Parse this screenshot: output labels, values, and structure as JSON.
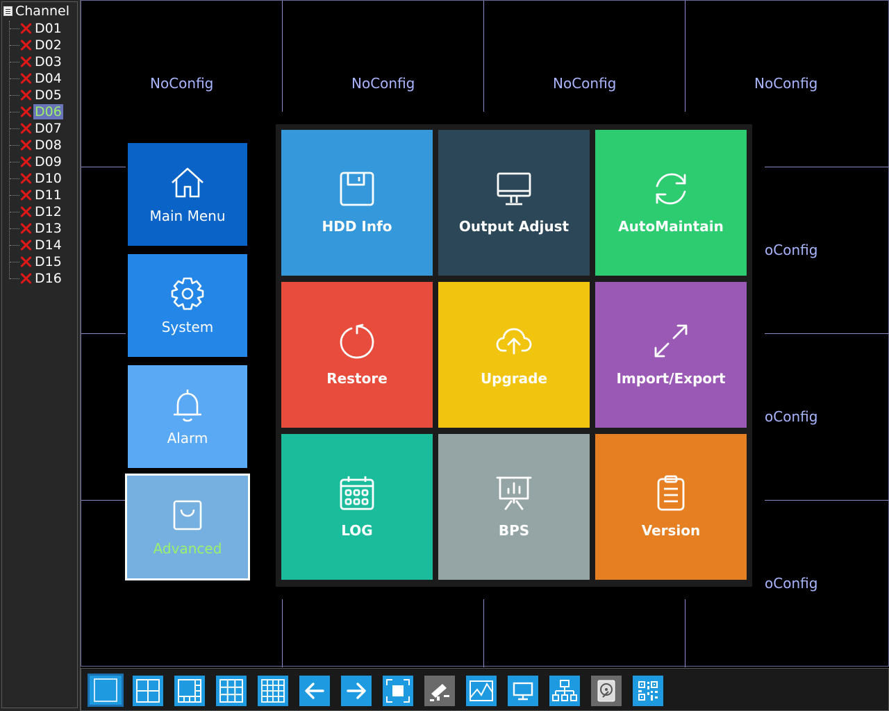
{
  "sidebar": {
    "title": "Channel",
    "channels": [
      "D01",
      "D02",
      "D03",
      "D04",
      "D05",
      "D06",
      "D07",
      "D08",
      "D09",
      "D10",
      "D11",
      "D12",
      "D13",
      "D14",
      "D15",
      "D16"
    ],
    "selected": "D06"
  },
  "grid": {
    "noconfig_top": [
      "NoConfig",
      "NoConfig",
      "NoConfig",
      "NoConfig"
    ],
    "noconfig_right": [
      "oConfig",
      "oConfig",
      "oConfig"
    ]
  },
  "side_menu": [
    {
      "label": "Main Menu",
      "icon": "home-icon",
      "color": "#0a63c7"
    },
    {
      "label": "System",
      "icon": "gear-icon",
      "color": "#2487e8"
    },
    {
      "label": "Alarm",
      "icon": "bell-icon",
      "color": "#5aa9f5"
    },
    {
      "label": "Advanced",
      "icon": "bag-icon",
      "color": "#76b0e0"
    }
  ],
  "tiles": [
    {
      "label": "HDD Info",
      "icon": "floppy-icon",
      "color": "#3498db"
    },
    {
      "label": "Output Adjust",
      "icon": "monitor-icon",
      "color": "#2c4858"
    },
    {
      "label": "AutoMaintain",
      "icon": "refresh-icon",
      "color": "#2ecc71"
    },
    {
      "label": "Restore",
      "icon": "restore-icon",
      "color": "#e74c3c"
    },
    {
      "label": "Upgrade",
      "icon": "cloud-upload-icon",
      "color": "#f1c40f"
    },
    {
      "label": "Import/Export",
      "icon": "expand-arrows-icon",
      "color": "#9b59b6"
    },
    {
      "label": "LOG",
      "icon": "calendar-icon",
      "color": "#1abc9c"
    },
    {
      "label": "BPS",
      "icon": "presentation-chart-icon",
      "color": "#95a5a6"
    },
    {
      "label": "Version",
      "icon": "clipboard-icon",
      "color": "#e67e22"
    }
  ],
  "toolbar": {
    "buttons": [
      "single-view-icon",
      "quad-view-icon",
      "eight-view-icon",
      "nine-view-icon",
      "sixteen-view-icon",
      "prev-icon",
      "next-icon",
      "fullscreen-icon",
      "ptz-camera-icon",
      "chart-icon",
      "monitor-icon",
      "network-icon",
      "hdd-icon",
      "qr-code-icon"
    ]
  }
}
